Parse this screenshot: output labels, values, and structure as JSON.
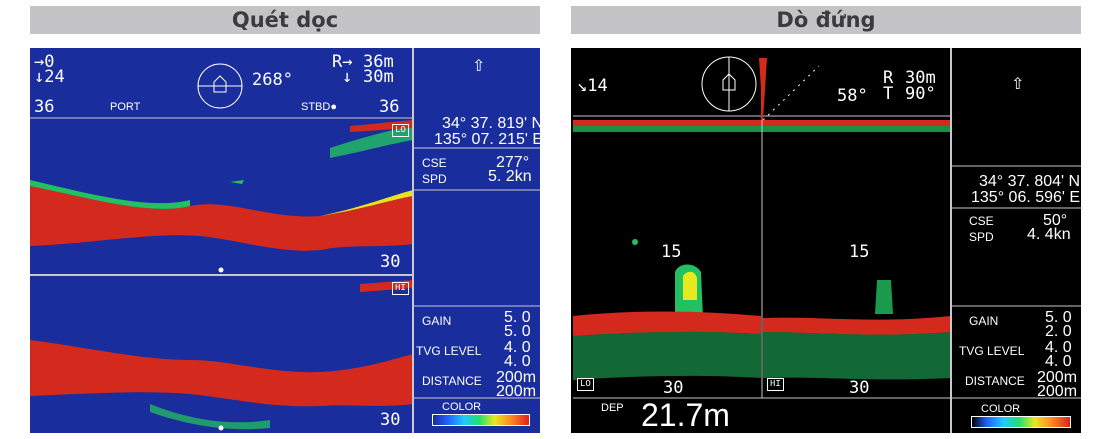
{
  "titles": {
    "left": "Quét dọc",
    "right": "Dò đứng"
  },
  "left_screen": {
    "top": {
      "arrow_right": "→0",
      "arrow_down": "↓24",
      "bearing": "268°",
      "range_r": "R→",
      "range_r_value": "36m",
      "range_down": "↓",
      "range_down_value": "30m",
      "row_left_num": "36",
      "port_label": "PORT",
      "stbd_label": "STBD●",
      "row_right_num": "36"
    },
    "upper_tag": "LO",
    "lower_tag": "HI",
    "upper_depth": "30",
    "lower_depth": "30",
    "side": {
      "lat": "34° 37. 819' N",
      "lon": "135° 07. 215' E",
      "cse_label": "CSE",
      "cse_value": "277°",
      "spd_label": "SPD",
      "spd_value": "5. 2kn",
      "gain_label": "GAIN",
      "gain_value_1": "5. 0",
      "gain_value_2": "5. 0",
      "tvg_label": "TVG LEVEL",
      "tvg_value_1": "4. 0",
      "tvg_value_2": "4. 0",
      "distance_label": "DISTANCE",
      "distance_value_1": "200m",
      "distance_value_2": "200m",
      "color_label": "COLOR"
    }
  },
  "right_screen": {
    "top": {
      "tilt": "↘14",
      "angle": "58°",
      "range_r_label": "R",
      "range_r_value": "30m",
      "range_t_label": "T",
      "range_t_value": "90°"
    },
    "depth_mark_left": "15",
    "depth_mark_right": "15",
    "bottom_left_tag": "LO",
    "bottom_right_tag": "HI",
    "bottom_left_depth": "30",
    "bottom_right_depth": "30",
    "dep_label": "DEP",
    "dep_value": "21.7m",
    "side": {
      "lat": "34° 37. 804' N",
      "lon": "135° 06. 596' E",
      "cse_label": "CSE",
      "cse_value": "50°",
      "spd_label": "SPD",
      "spd_value": "4. 4kn",
      "gain_label": "GAIN",
      "gain_value_1": "5. 0",
      "gain_value_2": "2. 0",
      "tvg_label": "TVG LEVEL",
      "tvg_value_1": "4. 0",
      "tvg_value_2": "4. 0",
      "distance_label": "DISTANCE",
      "distance_value_1": "200m",
      "distance_value_2": "200m",
      "color_label": "COLOR"
    }
  },
  "colors": {
    "left_bg": "#1a2d9c",
    "echo_red": "#d42a1e",
    "echo_green": "#22c060",
    "echo_yellow": "#e8e020",
    "right_bg": "#000000"
  }
}
